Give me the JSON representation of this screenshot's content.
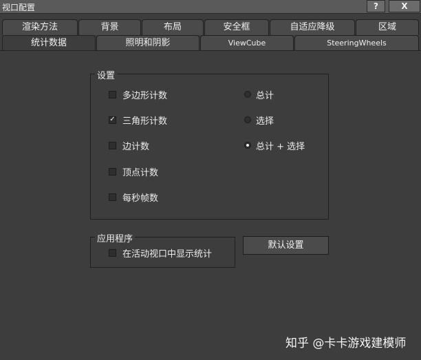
{
  "window": {
    "title": "视口配置",
    "help_label": "?",
    "close_label": "X"
  },
  "tabs_row1": [
    {
      "label": "渲染方法"
    },
    {
      "label": "背景"
    },
    {
      "label": "布局"
    },
    {
      "label": "安全框"
    },
    {
      "label": "自适应降级"
    },
    {
      "label": "区域"
    }
  ],
  "tabs_row2": [
    {
      "label": "统计数据",
      "active": true
    },
    {
      "label": "照明和阴影"
    },
    {
      "label": "ViewCube"
    },
    {
      "label": "SteeringWheels"
    }
  ],
  "settings": {
    "legend": "设置",
    "checkboxes": [
      {
        "label": "多边形计数",
        "checked": false,
        "mark": ""
      },
      {
        "label": "三角形计数",
        "checked": true,
        "mark": "✓"
      },
      {
        "label": "边计数",
        "checked": false,
        "mark": ""
      },
      {
        "label": "顶点计数",
        "checked": false,
        "mark": ""
      },
      {
        "label": "每秒帧数",
        "checked": false,
        "mark": ""
      }
    ],
    "radios": [
      {
        "label": "总计",
        "selected": false
      },
      {
        "label": "选择",
        "selected": false
      },
      {
        "label": "总计 + 选择",
        "selected": true
      }
    ]
  },
  "application": {
    "legend": "应用程序",
    "checkbox": {
      "label": "在活动视口中显示统计",
      "checked": false,
      "mark": ""
    },
    "default_button": "默认设置"
  },
  "watermark": "知乎 @卡卡游戏建模师"
}
